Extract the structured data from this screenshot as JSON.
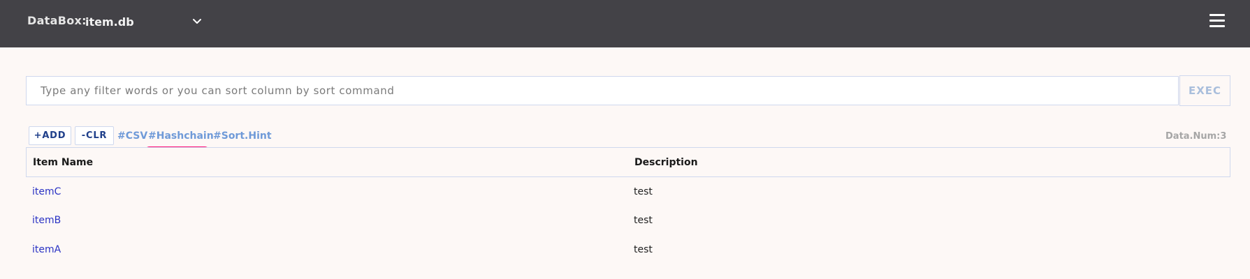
{
  "header": {
    "brand": "DataBox:",
    "db_name": "item.db",
    "dropdown_icon": "chevron-down-icon",
    "menu_icon": "hamburger-menu-icon"
  },
  "filter": {
    "placeholder": "Type any filter words or you can sort column by sort command",
    "value": "",
    "exec_label": "EXEC"
  },
  "toolbar": {
    "add_label": "+ADD",
    "clr_label": "-CLR",
    "tags": [
      "#CSV",
      "#Hashchain",
      "#Sort.Hint"
    ],
    "data_count": "Data.Num:3"
  },
  "table": {
    "columns": [
      "Item Name",
      "Description"
    ],
    "rows": [
      {
        "name": "itemC",
        "description": "test"
      },
      {
        "name": "itemB",
        "description": "test"
      },
      {
        "name": "itemA",
        "description": "test"
      }
    ]
  },
  "colors": {
    "topbar": "#434247",
    "background": "#fdf8f6",
    "link": "#2b33c4",
    "tag": "#6f9ad8",
    "highlight": "#ff0a73"
  }
}
